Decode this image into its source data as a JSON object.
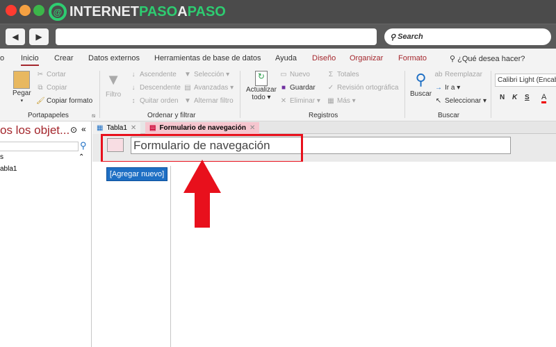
{
  "browser": {
    "logo_text_1": "INTERNET",
    "logo_text_2": "PASO",
    "logo_text_3": "A",
    "logo_text_4": "PASO",
    "back": "◀",
    "forward": "▶",
    "search_placeholder": "Search",
    "colors": {
      "close": "#ff3b30",
      "min": "#f5a142",
      "max": "#3cb64a",
      "accent": "#2ecc71"
    }
  },
  "ribbon_tabs": [
    "o",
    "Inicio",
    "Crear",
    "Datos externos",
    "Herramientas de base de datos",
    "Ayuda",
    "Diseño",
    "Organizar",
    "Formato"
  ],
  "tell_me": "¿Qué desea hacer?",
  "ribbon": {
    "portapapeles": {
      "pegar": "Pegar",
      "cortar": "Cortar",
      "copiar": "Copiar",
      "copiar_formato": "Copiar formato",
      "label": "Portapapeles"
    },
    "ordenar": {
      "filtro": "Filtro",
      "ascendente": "Ascendente",
      "descendente": "Descendente",
      "quitar_orden": "Quitar orden",
      "seleccion": "Selección ▾",
      "avanzadas": "Avanzadas ▾",
      "alternar": "Alternar filtro",
      "label": "Ordenar y filtrar"
    },
    "registros": {
      "actualizar": "Actualizar",
      "todo": "todo ▾",
      "nuevo": "Nuevo",
      "guardar": "Guardar",
      "eliminar": "Eliminar ▾",
      "totales": "Totales",
      "revision": "Revisión ortográfica",
      "mas": "Más ▾",
      "label": "Registros"
    },
    "buscar": {
      "buscar": "Buscar",
      "reemplazar": "Reemplazar",
      "ir_a": "Ir a ▾",
      "seleccionar": "Seleccionar ▾",
      "label": "Buscar"
    },
    "fuente": {
      "font": "Calibri Light (Encabe",
      "bold": "N",
      "italic": "K",
      "underline": "S",
      "color": "A"
    }
  },
  "nav_pane": {
    "title": "os los objet...",
    "collapse": "«",
    "section": "s",
    "item": "abla1"
  },
  "doc_tabs": [
    {
      "label": "Tabla1"
    },
    {
      "label": "Formulario de navegación"
    }
  ],
  "form": {
    "title": "Formulario de navegación",
    "add_new": "[Agregar nuevo]"
  }
}
